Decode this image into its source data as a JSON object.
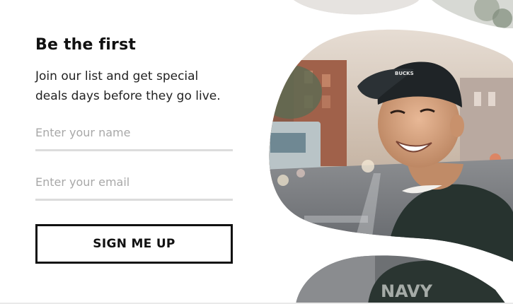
{
  "signup": {
    "title": "Be the first",
    "subtitle": "Join our list and get special deals days before they go live.",
    "name_placeholder": "Enter your name",
    "email_placeholder": "Enter your email",
    "submit_label": "SIGN ME UP"
  },
  "photo": {
    "cap_text": "BUCKS",
    "shirt_text": "NAVY"
  },
  "colors": {
    "text": "#111111",
    "placeholder": "#a8a8a8",
    "underline": "#dcdcdc",
    "button_border": "#111111",
    "background": "#ffffff"
  }
}
